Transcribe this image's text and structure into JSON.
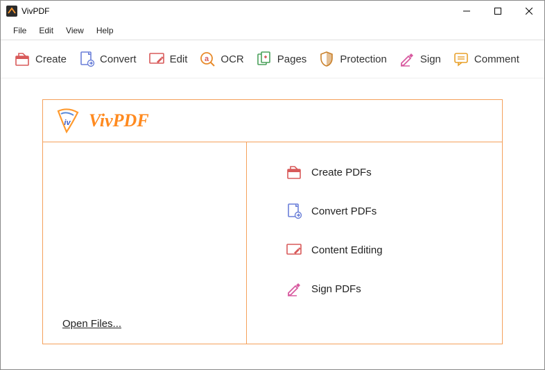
{
  "window": {
    "title": "VivPDF"
  },
  "menu": {
    "file": "File",
    "edit": "Edit",
    "view": "View",
    "help": "Help"
  },
  "toolbar": {
    "create": "Create",
    "convert": "Convert",
    "edit": "Edit",
    "ocr": "OCR",
    "pages": "Pages",
    "protection": "Protection",
    "sign": "Sign",
    "comment": "Comment"
  },
  "welcome": {
    "logo_text": "VivPDF",
    "open_files": "Open Files...",
    "actions": {
      "create": "Create PDFs",
      "convert": "Convert PDFs",
      "edit": "Content Editing",
      "sign": "Sign PDFs"
    }
  }
}
